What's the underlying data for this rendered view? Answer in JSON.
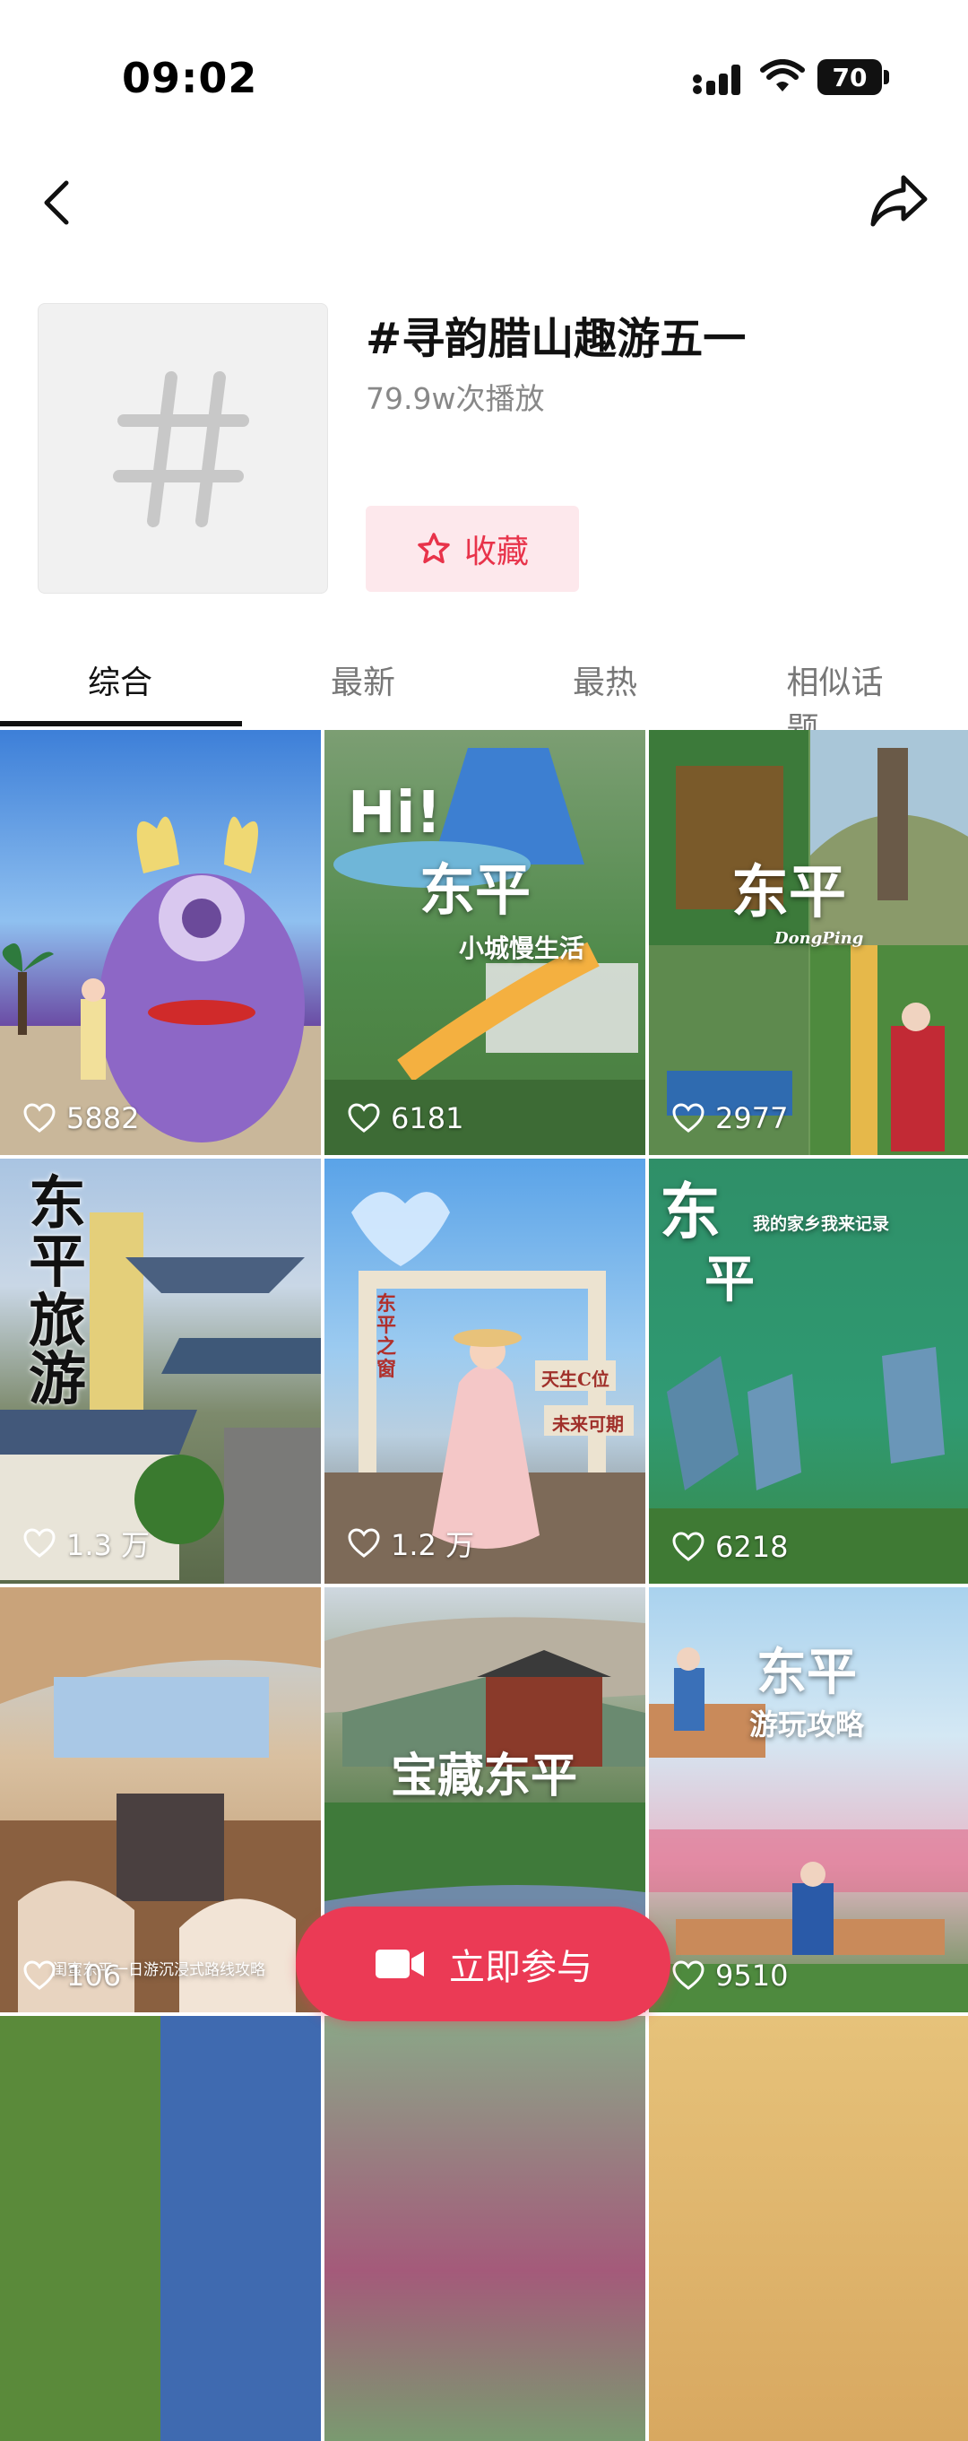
{
  "status_bar": {
    "time": "09:02",
    "battery": "70"
  },
  "topic": {
    "title": "#寻韵腊山趣游五一",
    "plays": "79.9w次播放",
    "favorite_label": "收藏"
  },
  "tabs": [
    {
      "label": "综合",
      "active": true
    },
    {
      "label": "最新",
      "active": false
    },
    {
      "label": "最热",
      "active": false
    },
    {
      "label": "相似话题",
      "active": false
    }
  ],
  "videos": [
    {
      "likes": "5882"
    },
    {
      "likes": "6181",
      "overlay": [
        "Hi!",
        "东平",
        "小城慢生活"
      ]
    },
    {
      "likes": "2977",
      "overlay": [
        "东平",
        "DongPing"
      ]
    },
    {
      "likes": "1.3 万",
      "overlay": [
        "东平旅游"
      ]
    },
    {
      "likes": "1.2 万",
      "overlay": [
        "东平之窗",
        "天生C位",
        "未来可期"
      ]
    },
    {
      "likes": "6218",
      "overlay": [
        "东",
        "平",
        "我的家乡我来记录"
      ]
    },
    {
      "likes": "106",
      "overlay": [
        "闺蜜东平一日游沉浸式路线攻略"
      ]
    },
    {
      "likes": "",
      "overlay": [
        "宝藏东平"
      ]
    },
    {
      "likes": "9510",
      "overlay": [
        "东平",
        "游玩攻略"
      ]
    }
  ],
  "join_button": {
    "label": "立即参与"
  },
  "colors": {
    "accent": "#eb3a55",
    "favorite_bg": "#fde8ec"
  }
}
